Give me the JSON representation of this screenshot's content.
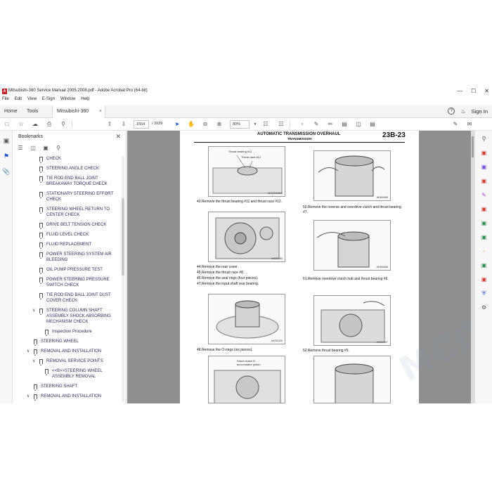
{
  "window": {
    "title": "Mitsubishi-380  Service Manual 2005.2008.pdf - Adobe Acrobat Pro (64-bit)",
    "minimize": "—",
    "maximize": "☐",
    "close": "✕"
  },
  "menu": [
    "File",
    "Edit",
    "View",
    "E-Sign",
    "Window",
    "Help"
  ],
  "tabs": {
    "home": "Home",
    "tools": "Tools",
    "document": "Mitsubishi-380  Ser...",
    "close": "×"
  },
  "header_right": {
    "help": "?",
    "bell": "🔔",
    "signin": "Sign In"
  },
  "toolbar": {
    "page_current": "1554",
    "page_total": "/  3939",
    "zoom": "80%"
  },
  "bookmarks": {
    "title": "Bookmarks",
    "close": "✕",
    "items": [
      {
        "label": "CHECK",
        "indent": 3,
        "lines": 1
      },
      {
        "label": "STEERING ANGLE CHECK",
        "indent": 3,
        "lines": 1
      },
      {
        "label": "TIE ROD END BALL JOINT BREAKAWAY TORQUE CHECK",
        "indent": 3,
        "lines": 2
      },
      {
        "label": "STATIONARY STEERING EFFORT CHECK",
        "indent": 3,
        "lines": 2
      },
      {
        "label": "STEERING WHEEL RETURN TO CENTER CHECK",
        "indent": 3,
        "lines": 2
      },
      {
        "label": "DRIVE BELT TENSION CHECK",
        "indent": 3,
        "lines": 1
      },
      {
        "label": "FLUID LEVEL CHECK",
        "indent": 3,
        "lines": 1
      },
      {
        "label": "FLUID REPLACEMENT",
        "indent": 3,
        "lines": 1
      },
      {
        "label": "POWER STEERING SYSTEM AIR BLEEDING",
        "indent": 3,
        "lines": 2
      },
      {
        "label": "OIL PUMP PRESSURE TEST",
        "indent": 3,
        "lines": 1
      },
      {
        "label": "POWER STEERING PRESSURE SWITCH CHECK",
        "indent": 3,
        "lines": 2
      },
      {
        "label": "TIE ROD END BALL JOINT DUST COVER CHECK",
        "indent": 3,
        "lines": 2
      },
      {
        "label": "STEERING COLUMN SHAFT ASSEMBLY SHOCK ABSORBING MECHANISM CHECK",
        "indent": 3,
        "lines": 3,
        "expanded": true
      },
      {
        "label": "Inspection Procedure",
        "indent": 4,
        "lines": 1,
        "lower": true
      },
      {
        "label": "STEERING WHEEL",
        "indent": 2,
        "lines": 1
      },
      {
        "label": "REMOVAL AND INSTALLATION",
        "indent": 2,
        "lines": 1,
        "expanded": true
      },
      {
        "label": "REMOVAL SERVICE POINTS",
        "indent": 3,
        "lines": 1,
        "expanded": true
      },
      {
        "label": "<<B>>STEERING WHEEL ASSEMBLY REMOVAL",
        "indent": 4,
        "lines": 2
      },
      {
        "label": "STEERING SHAFT",
        "indent": 2,
        "lines": 1
      },
      {
        "label": "REMOVAL AND INSTALLATION",
        "indent": 2,
        "lines": 1,
        "expanded": true
      }
    ]
  },
  "page": {
    "header_title": "AUTOMATIC TRANSMISSION OVERHAUL",
    "header_sub": "TRANSMISSION",
    "page_number": "23B-23",
    "figures": [
      {
        "code": "AK203116AG",
        "callouts": [
          "Thrust bearing #11",
          "Thrust race #12"
        ]
      },
      {
        "code": "AK300465",
        "callouts": []
      },
      {
        "code": "AK300483",
        "callouts": []
      },
      {
        "code": "AK300466",
        "callouts": []
      },
      {
        "code": "AK203120",
        "callouts": []
      },
      {
        "code": "AK300467",
        "callouts": []
      },
      {
        "code": "",
        "callouts": [
          "Direct clutch D",
          "accumulator piston"
        ]
      },
      {
        "code": "",
        "callouts": []
      }
    ],
    "steps": {
      "s43": "43.Remove the thrust bearing #11 and thrust race #12.",
      "s44": "44.Remove the rear cover.",
      "s45": "45.Remove the thrust race #8.",
      "s46": "46.Remove the seal rings (four pieces).",
      "s47": "47.Remove the input shaft rear bearing.",
      "s48": "48.Remove the O-rings (six pieces).",
      "s50": "50.Remove the reverse and overdrive clutch and thrust bearing #7.",
      "s51": "51.Remove overdrive clutch hub and thrust bearing #6.",
      "s52": "52.Remove thrust bearing #5."
    }
  },
  "watermark": "MCD.COM",
  "colors": {
    "doc_background": "#8f8f8f",
    "brand_red": "#c7202a",
    "bookmark_text": "#2b2b58"
  }
}
